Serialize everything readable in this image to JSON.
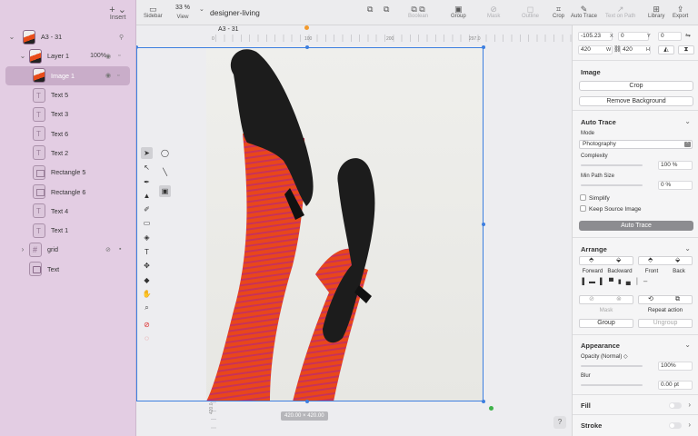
{
  "toolbar": {
    "insert": "Insert",
    "sidebar": "Sidebar",
    "zoom_value": "33 %",
    "view": "View",
    "doc_title": "designer-living",
    "boolean": "Boolean",
    "group": "Group",
    "mask": "Mask",
    "outline": "Outline",
    "crop": "Crop",
    "auto_trace": "Auto Trace",
    "text_on_path": "Text on Path",
    "library": "Library",
    "export": "Export"
  },
  "layers": [
    {
      "name": "A3 - 31",
      "type": "img",
      "level": 0,
      "chevron": "⌄"
    },
    {
      "name": "Layer 1",
      "type": "img",
      "level": 1,
      "chevron": "⌄",
      "opacity": "100%"
    },
    {
      "name": "Image 1",
      "type": "img",
      "level": 2,
      "selected": true
    },
    {
      "name": "Text 5",
      "type": "text",
      "level": 2
    },
    {
      "name": "Text 3",
      "type": "text",
      "level": 2
    },
    {
      "name": "Text 6",
      "type": "text",
      "level": 2
    },
    {
      "name": "Text 2",
      "type": "text",
      "level": 2
    },
    {
      "name": "Rectangle 5",
      "type": "rect",
      "level": 2
    },
    {
      "name": "Rectangle 6",
      "type": "rect",
      "level": 2
    },
    {
      "name": "Text 4",
      "type": "text",
      "level": 2
    },
    {
      "name": "Text 1",
      "type": "text",
      "level": 2
    },
    {
      "name": "grid",
      "type": "grid",
      "level": 1,
      "chevron": "›"
    },
    {
      "name": "Text",
      "type": "frame",
      "level": 1
    }
  ],
  "canvas": {
    "artboard_label": "A3 - 31",
    "ruler_top": [
      "0",
      "100",
      "200",
      "297.0"
    ],
    "ruler_left": [
      "100",
      "200",
      "300",
      "420.0"
    ],
    "size_badge": "420.00 × 420.00",
    "help": "?"
  },
  "inspector": {
    "x": "-105.23",
    "x_label": "X",
    "y": "0",
    "y_label": "Y",
    "rotation": "0",
    "w": "420",
    "w_label": "W",
    "h": "420",
    "h_label": "H",
    "image_title": "Image",
    "crop": "Crop",
    "remove_bg": "Remove Background",
    "auto_trace_title": "Auto Trace",
    "mode_label": "Mode",
    "mode_value": "Photography",
    "complexity_label": "Complexity",
    "complexity_value": "100 %",
    "min_path_label": "Min Path Size",
    "min_path_value": "0 %",
    "simplify": "Simplify",
    "keep_source": "Keep Source Image",
    "auto_trace_btn": "Auto Trace",
    "arrange_title": "Arrange",
    "forward": "Forward",
    "backward": "Backward",
    "front": "Front",
    "back": "Back",
    "mask": "Mask",
    "repeat_action": "Repeat action",
    "group": "Group",
    "ungroup": "Ungroup",
    "appearance_title": "Appearance",
    "opacity_label": "Opacity (Normal) ◇",
    "opacity_value": "100%",
    "blur_label": "Blur",
    "blur_value": "0.00 pt",
    "fill_title": "Fill",
    "stroke_title": "Stroke"
  },
  "colors": {
    "sidebar_bg": "#e3cde3",
    "selection": "#3d7fe0",
    "stocking_orange": "#e8471a",
    "stocking_stripe": "#c8325a",
    "shoe": "#1c1c1c"
  }
}
